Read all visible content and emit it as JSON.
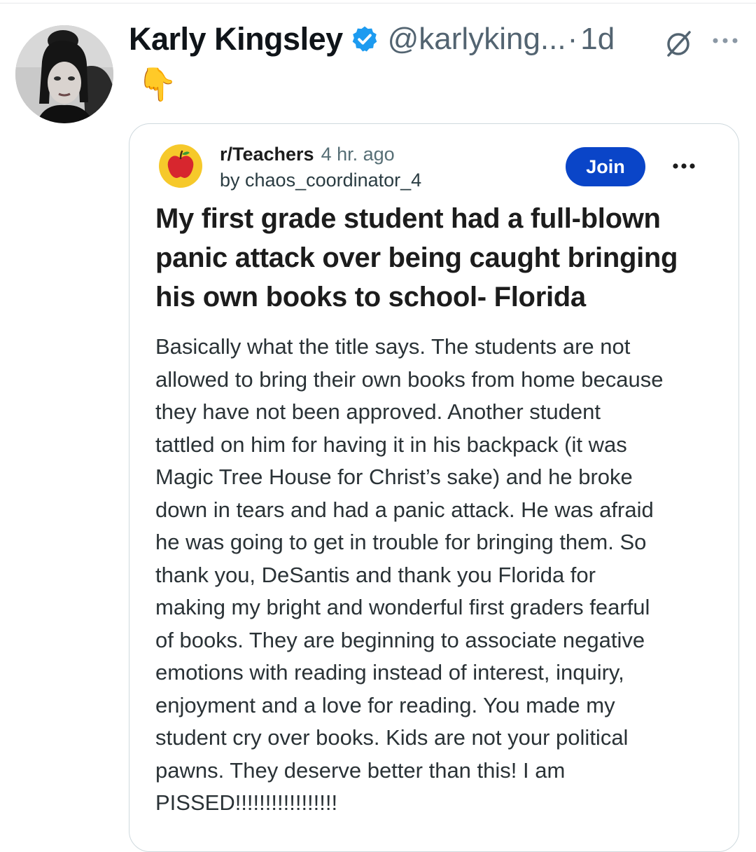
{
  "tweet": {
    "display_name": "Karly Kingsley",
    "handle": "@karlyking...",
    "separator": "·",
    "time": "1d",
    "text": "👇",
    "icons": {
      "verified": "verified-badge-icon",
      "grok": "grok-icon",
      "more": "more-dots-icon"
    },
    "colors": {
      "verified": "#1d9bf0",
      "secondary_text": "#536471"
    }
  },
  "quoted_post": {
    "subreddit": "r/Teachers",
    "age": "4 hr. ago",
    "author": "by chaos_coordinator_4",
    "join_label": "Join",
    "title": "My first grade student had a full-blown panic attack over being caught bringing his own books to school- Florida",
    "body_lines": [
      "Basically what the title says. The students are not",
      "allowed to bring their own books from home because",
      "they have not been approved. Another student",
      "tattled on him for having it in his backpack (it was",
      "Magic Tree House for Christ’s sake) and he broke",
      "down in tears and had a panic attack. He was afraid",
      "he was going to get in trouble for bringing them. So",
      "thank you, DeSantis and thank you Florida for",
      "making my bright and wonderful first graders fearful",
      "of books. They are beginning to associate negative",
      "emotions with reading instead of interest, inquiry,",
      "enjoyment and a love for reading. You made my",
      "student cry over books. Kids are not your political",
      "pawns. They deserve better than this! I am",
      "PISSED!!!!!!!!!!!!!!!!!"
    ],
    "icons": {
      "subreddit": "apple-icon",
      "menu": "more-dots-icon"
    },
    "colors": {
      "join_button": "#0a45c8",
      "subreddit_icon_bg": "#f6c92b",
      "apple": "#d7262e"
    }
  }
}
